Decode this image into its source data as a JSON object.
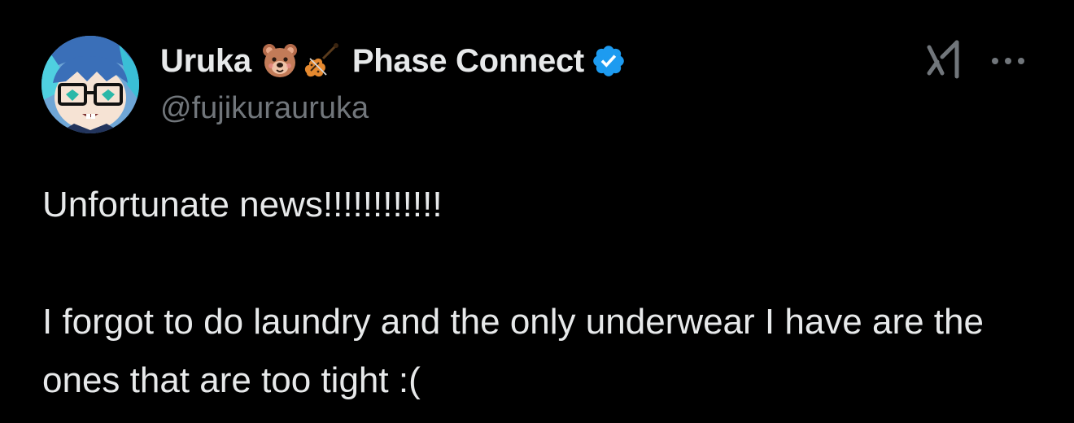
{
  "author": {
    "display_name": "Uruka",
    "emojis": [
      "bear-face-icon",
      "violin-icon"
    ],
    "affiliation": "Phase Connect",
    "verified": true,
    "handle": "@fujikurauruka",
    "avatar_icon": "avatar-anime-girl-with-glasses"
  },
  "header_actions": {
    "grok_icon": "grok-icon",
    "more_icon": "more-dots-icon"
  },
  "tweet": {
    "lines": [
      "Unfortunate news!!!!!!!!!!!!",
      "I forgot to do laundry and the only underwear I have are the ones that are too tight :("
    ]
  },
  "colors": {
    "background": "#000000",
    "primary_text": "#e7e9ea",
    "secondary_text": "#71767b",
    "verified_blue": "#1d9bf0"
  }
}
